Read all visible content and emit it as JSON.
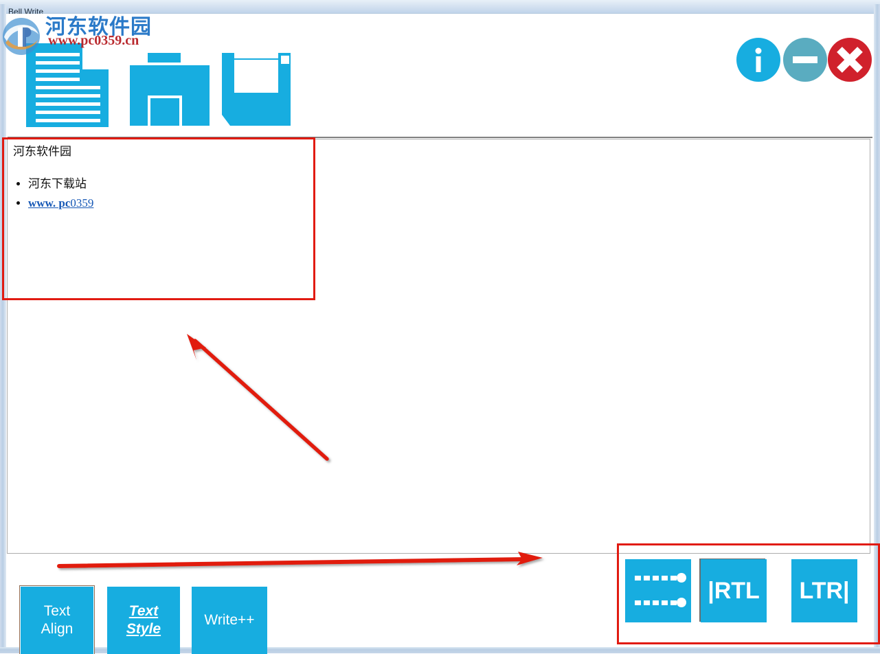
{
  "window": {
    "title": "Bell Write",
    "accent_color": "#17ade0",
    "annotation_color": "#e11b11"
  },
  "titlebar": {
    "title": "Bell Write"
  },
  "watermark": {
    "brand_cn": "河东软件园",
    "url": "www.pc0359.cn",
    "logo_icon": "pc0359-logo-icon"
  },
  "toolbar": {
    "buttons": [
      {
        "name": "new-document-button",
        "icon": "new-document-icon",
        "label": "New Document"
      },
      {
        "name": "open-folder-button",
        "icon": "open-folder-icon",
        "label": "Open"
      },
      {
        "name": "save-button",
        "icon": "save-floppy-icon",
        "label": "Save"
      }
    ]
  },
  "window_controls": [
    {
      "name": "info-button",
      "icon": "info-circle-icon",
      "glyph": "i",
      "color": "#17ade0"
    },
    {
      "name": "minimize-button",
      "icon": "minimize-circle-icon",
      "glyph": "—",
      "color": "#5aacc0"
    },
    {
      "name": "close-button",
      "icon": "close-circle-icon",
      "glyph": "✕",
      "color": "#d0212c"
    }
  ],
  "editor": {
    "heading": "河东软件园",
    "list_items": [
      {
        "text": "河东下载站",
        "is_link": false
      },
      {
        "text": "www. pc0359",
        "is_link": true,
        "link_bold_part": "www. pc",
        "link_plain_part": "0359"
      }
    ]
  },
  "bottom_bar": {
    "left_buttons": [
      {
        "name": "text-align-button",
        "line1": "Text",
        "line2": "Align",
        "selected": true
      },
      {
        "name": "text-style-button",
        "line1": "Text",
        "line2": "Style",
        "selected": false
      },
      {
        "name": "write-plus-plus-button",
        "line1": "Write++",
        "line2": "",
        "selected": false
      }
    ],
    "direction_buttons": [
      {
        "name": "bullet-list-button",
        "icon": "bullet-list-rtl-icon",
        "label": ""
      },
      {
        "name": "rtl-button",
        "icon": "rtl-icon",
        "label": "|RTL"
      },
      {
        "name": "ltr-button",
        "icon": "ltr-icon",
        "label": "LTR|"
      }
    ]
  },
  "annotations": {
    "box_editor_label": "editor-area-highlight",
    "box_direction_label": "direction-buttons-highlight",
    "arrow_diagonal_label": "arrow-to-editor",
    "arrow_horizontal_label": "arrow-to-direction-buttons"
  }
}
